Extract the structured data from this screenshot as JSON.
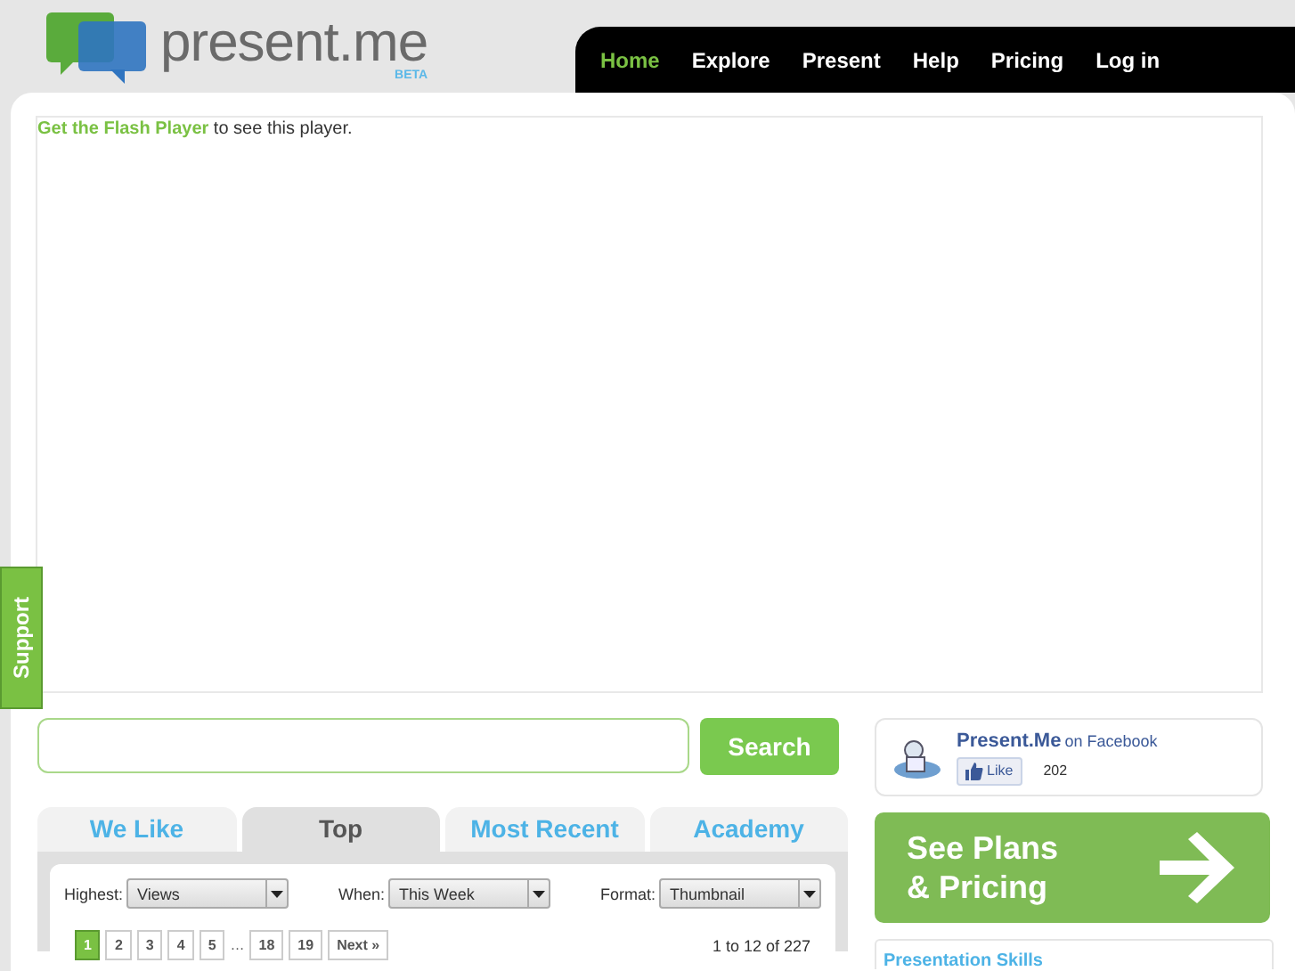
{
  "logo": {
    "name": "present.me",
    "badge": "BETA"
  },
  "nav": [
    {
      "label": "Home",
      "selected": true
    },
    {
      "label": "Explore",
      "selected": false
    },
    {
      "label": "Present",
      "selected": false
    },
    {
      "label": "Help",
      "selected": false
    },
    {
      "label": "Pricing",
      "selected": false
    },
    {
      "label": "Log in",
      "selected": false
    }
  ],
  "player": {
    "link": "Get the Flash Player",
    "text": "to see this player."
  },
  "support_tab": "Support",
  "search": {
    "button": "Search"
  },
  "tabs": [
    {
      "label": "We Like",
      "selected": false
    },
    {
      "label": "Top",
      "selected": true
    },
    {
      "label": "Most Recent",
      "selected": false
    },
    {
      "label": "Academy",
      "selected": false
    }
  ],
  "filters": [
    {
      "label": "Highest:",
      "value": "Views"
    },
    {
      "label": "When:",
      "value": "This Week"
    },
    {
      "label": "Format:",
      "value": "Thumbnail"
    }
  ],
  "pagination": {
    "pages": [
      {
        "label": "1",
        "selected": true
      },
      {
        "label": "2",
        "selected": false
      },
      {
        "label": "3",
        "selected": false
      },
      {
        "label": "4",
        "selected": false
      },
      {
        "label": "5",
        "selected": false
      },
      {
        "label": "…",
        "kind": "gap"
      },
      {
        "label": "18",
        "selected": false
      },
      {
        "label": "19",
        "selected": false
      }
    ],
    "next": "Next »",
    "count": "1 to 12 of 227"
  },
  "facebook": {
    "name": "Present.Me",
    "suffix": "on Facebook",
    "like": "Like",
    "likes": "202"
  },
  "plans_banner": {
    "line1": "See Plans",
    "line2": "& Pricing"
  },
  "sidebar_box": {
    "title": "Presentation Skills"
  }
}
